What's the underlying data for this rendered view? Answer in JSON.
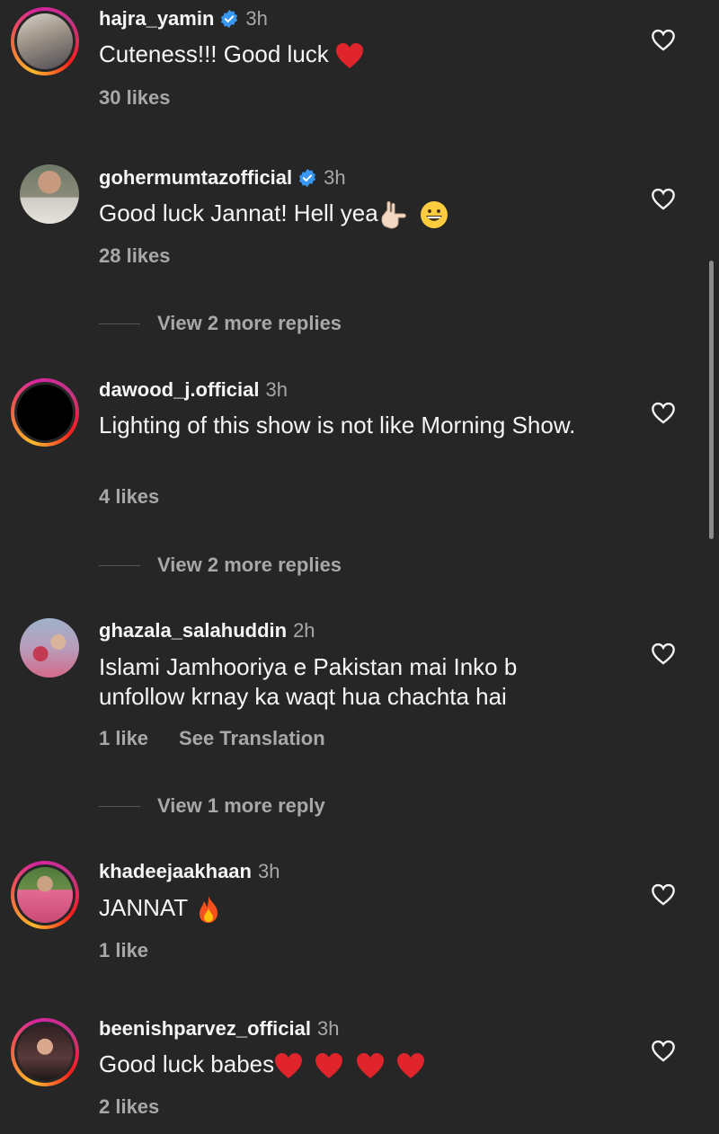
{
  "comments": [
    {
      "username": "hajra_yamin",
      "verified": true,
      "time": "3h",
      "text": "Cuteness!!! Good luck",
      "likes": "30 likes",
      "avatar": "avatar-photo"
    },
    {
      "username": "gohermumtazofficial",
      "verified": true,
      "time": "3h",
      "text": "Good luck Jannat! Hell yea",
      "likes": "28 likes",
      "avatar": "avatar-photo"
    },
    {
      "username": "dawood_j.official",
      "verified": false,
      "time": "3h",
      "text": "Lighting of this show is not like Morning Show.",
      "likes": "4 likes",
      "avatar": "avatar-photo"
    },
    {
      "username": "ghazala_salahuddin",
      "verified": false,
      "time": "2h",
      "text": "Islami Jamhooriya e Pakistan mai Inko b unfollow krnay ka waqt hua chachta hai",
      "likes": "1 like",
      "translation": "See Translation",
      "avatar": "avatar-photo"
    },
    {
      "username": "khadeejaakhaan",
      "verified": false,
      "time": "3h",
      "text": "JANNAT",
      "likes": "1 like",
      "avatar": "avatar-photo"
    },
    {
      "username": "beenishparvez_official",
      "verified": false,
      "time": "3h",
      "text": "Good luck babes",
      "likes": "2 likes",
      "avatar": "avatar-photo"
    }
  ],
  "view_replies": [
    "View 2 more replies",
    "View 2 more replies",
    "View 1 more reply"
  ],
  "icons": {
    "heart": "heart-outline-icon",
    "verified": "verified-badge-icon"
  },
  "colors": {
    "background": "#262626",
    "text": "#f5f5f5",
    "secondary": "#a8a8a8",
    "verified": "#3897f0",
    "heart_emoji": "#e0242b"
  }
}
